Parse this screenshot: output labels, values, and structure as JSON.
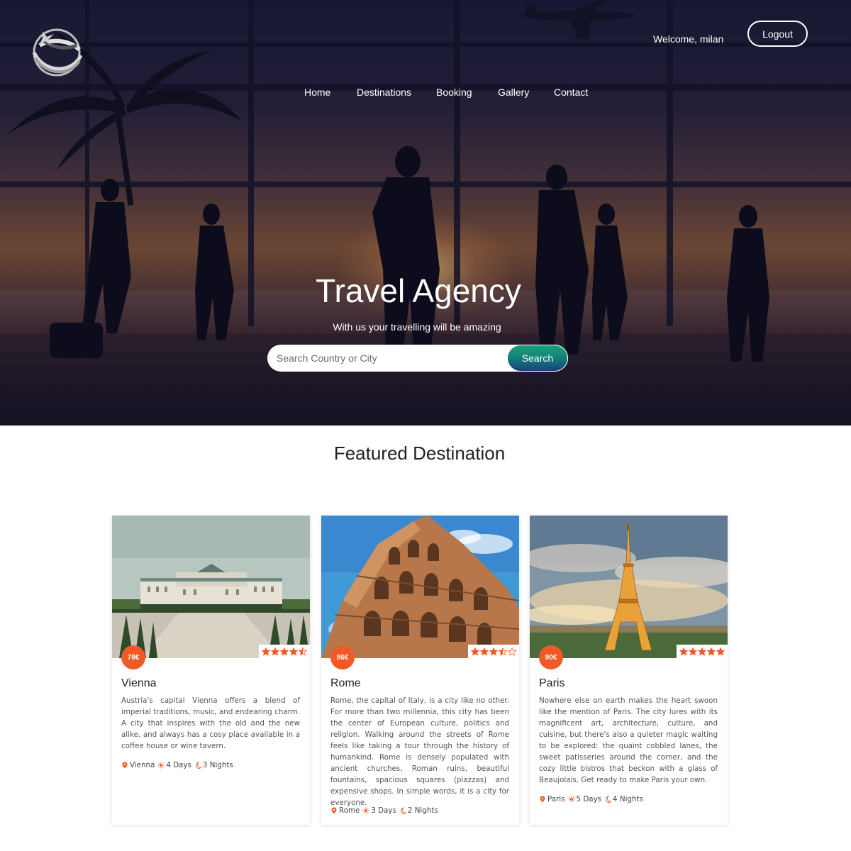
{
  "header": {
    "welcome": "Welcome, milan",
    "logout_label": "Logout"
  },
  "nav": {
    "items": [
      "Home",
      "Destinations",
      "Booking",
      "Gallery",
      "Contact"
    ]
  },
  "hero": {
    "title": "Travel Agency",
    "subtitle": "With us your travelling will be amazing",
    "search_placeholder": "Search Country or City",
    "search_label": "Search"
  },
  "featured": {
    "title": "Featured Destination",
    "cards": [
      {
        "title": "Vienna",
        "price": "78€",
        "rating": 4.5,
        "description": "Austria's capital Vienna offers a blend of imperial traditions, music, and endearing charm. A city that inspires with the old and the new alike, and always has a cosy place available in a coffee house or wine tavern.",
        "location": "Vienna",
        "days": "4 Days",
        "nights": "3 Nights"
      },
      {
        "title": "Rome",
        "price": "86€",
        "rating": 3.5,
        "description": "Rome, the capital of Italy, is a city like no other. For more than two millennia, this city has been the center of European culture, politics and religion. Walking around the streets of Rome feels like taking a tour through the history of humankind. Rome is densely populated with ancient churches, Roman ruins, beautiful fountains, spacious squares (piazzas) and expensive shops. In simple words, it is a city for everyone.",
        "location": "Rome",
        "days": "3 Days",
        "nights": "2 Nights"
      },
      {
        "title": "Paris",
        "price": "90€",
        "rating": 5,
        "description": "Nowhere else on earth makes the heart swoon like the mention of Paris. The city lures with its magnificent art, architecture, culture, and cuisine, but there's also a quieter magic waiting to be explored: the quaint cobbled lanes, the sweet patisseries around the corner, and the cozy little bistros that beckon with a glass of Beaujolais. Get ready to make Paris your own.",
        "location": "Paris",
        "days": "5 Days",
        "nights": "4 Nights"
      }
    ]
  },
  "colors": {
    "accent": "#f05a28",
    "search_gradient_top": "#1aa37a",
    "search_gradient_bottom": "#1d3f7a"
  },
  "icons": {
    "location": "map-pin-icon",
    "days": "sun-icon",
    "nights": "moon-icon",
    "rating": "star-icon"
  }
}
